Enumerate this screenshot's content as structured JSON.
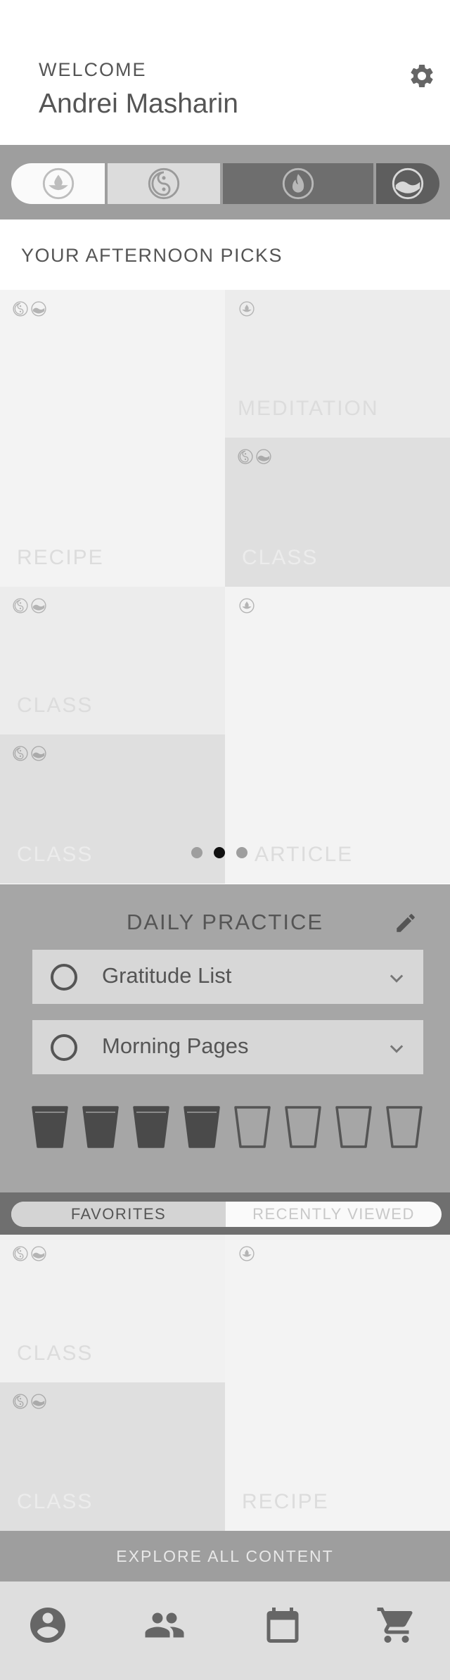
{
  "header": {
    "welcome": "WELCOME",
    "user_name": "Andrei Masharin",
    "settings_icon": "gear-icon"
  },
  "categories": [
    {
      "icon": "drop-icon",
      "state": "selected"
    },
    {
      "icon": "yin-yang-icon",
      "state": "normal"
    },
    {
      "icon": "flame-icon",
      "state": "dark"
    },
    {
      "icon": "wave-icon",
      "state": "dark"
    }
  ],
  "picks": {
    "heading": "YOUR AFTERNOON PICKS",
    "tiles": [
      {
        "label": "RECIPE",
        "badges": [
          "yin-yang-icon",
          "wave-icon"
        ]
      },
      {
        "label": "MEDITATION",
        "badges": [
          "drop-icon"
        ]
      },
      {
        "label": "CLASS",
        "badges": [
          "yin-yang-icon",
          "wave-icon"
        ]
      },
      {
        "label": "CLASS",
        "badges": [
          "yin-yang-icon",
          "wave-icon"
        ]
      },
      {
        "label": "ARTICLE",
        "badges": [
          "drop-icon"
        ]
      },
      {
        "label": "CLASS",
        "badges": [
          "yin-yang-icon",
          "wave-icon"
        ]
      }
    ],
    "carousel_pages": 3,
    "carousel_active": 2
  },
  "daily_practice": {
    "title": "DAILY PRACTICE",
    "edit_icon": "pencil-icon",
    "items": [
      {
        "name": "Gratitude List",
        "checked": false
      },
      {
        "name": "Morning Pages",
        "checked": false
      }
    ],
    "water_cups_total": 8,
    "water_cups_filled": 4
  },
  "collections": {
    "tabs": [
      {
        "label": "FAVORITES",
        "active": true
      },
      {
        "label": "RECENTLY VIEWED",
        "active": false
      }
    ],
    "tiles": [
      {
        "label": "CLASS",
        "badges": [
          "yin-yang-icon",
          "wave-icon"
        ]
      },
      {
        "label": "RECIPE",
        "badges": [
          "drop-icon"
        ]
      },
      {
        "label": "CLASS",
        "badges": [
          "yin-yang-icon",
          "wave-icon"
        ]
      }
    ]
  },
  "explore": {
    "label": "EXPLORE ALL CONTENT"
  },
  "bottom_nav": [
    {
      "icon": "profile-icon"
    },
    {
      "icon": "community-icon"
    },
    {
      "icon": "calendar-icon"
    },
    {
      "icon": "cart-icon"
    }
  ]
}
